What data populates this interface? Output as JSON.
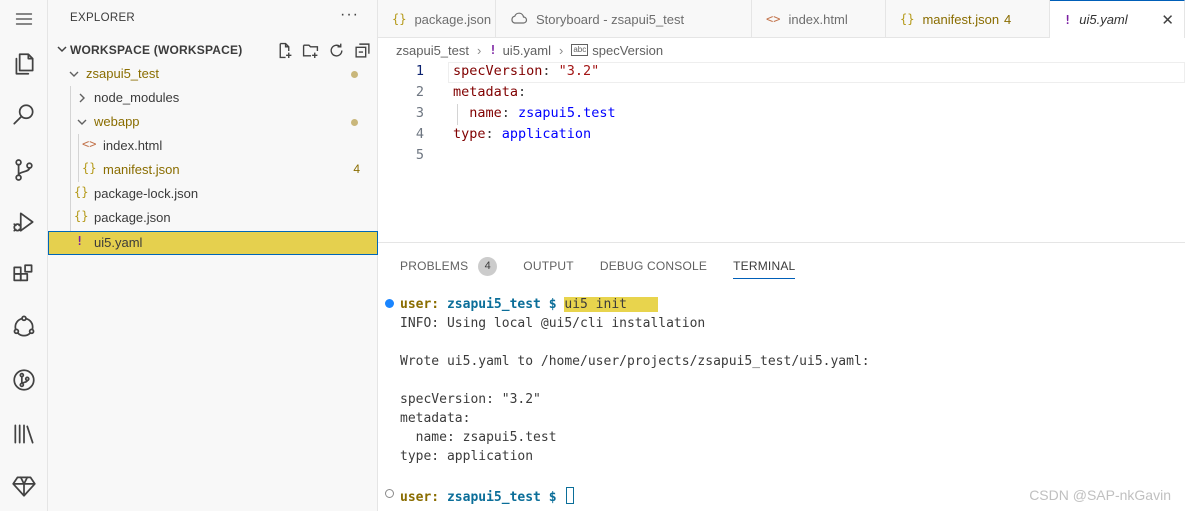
{
  "sidebar": {
    "title": "EXPLORER",
    "more": "···",
    "workspace_label": "WORKSPACE (WORKSPACE)",
    "items": [
      {
        "label": "zsapui5_test",
        "icon": "",
        "count": ""
      },
      {
        "label": "node_modules",
        "icon": "",
        "count": ""
      },
      {
        "label": "webapp",
        "icon": "",
        "count": ""
      },
      {
        "label": "index.html",
        "icon": "<>",
        "count": ""
      },
      {
        "label": "manifest.json",
        "icon": "{}",
        "count": "4"
      },
      {
        "label": "package-lock.json",
        "icon": "{}",
        "count": ""
      },
      {
        "label": "package.json",
        "icon": "{}",
        "count": ""
      },
      {
        "label": "ui5.yaml",
        "icon": "!",
        "count": ""
      }
    ]
  },
  "tabs": [
    {
      "label": "package.json",
      "icon": "{}",
      "count": ""
    },
    {
      "label": "Storyboard - zsapui5_test",
      "icon": "cloud-icon",
      "count": ""
    },
    {
      "label": "index.html",
      "icon": "<>",
      "count": ""
    },
    {
      "label": "manifest.json",
      "icon": "{}",
      "count": "4"
    },
    {
      "label": "ui5.yaml",
      "icon": "!",
      "count": "",
      "close": "✕"
    }
  ],
  "breadcrumb": {
    "folder": "zsapui5_test",
    "file": "ui5.yaml",
    "symbol_icon": "abc",
    "symbol": "specVersion"
  },
  "editor": {
    "line_numbers": [
      "1",
      "2",
      "3",
      "4",
      "5"
    ],
    "lines": [
      {
        "key": "specVersion",
        "sep": ": ",
        "val": "\"3.2\"",
        "val_kind": "s",
        "indent": ""
      },
      {
        "key": "metadata",
        "sep": ":",
        "val": "",
        "val_kind": "v",
        "indent": ""
      },
      {
        "key": "name",
        "sep": ": ",
        "val": "zsapui5.test",
        "val_kind": "v",
        "indent": "  "
      },
      {
        "key": "type",
        "sep": ": ",
        "val": "application",
        "val_kind": "v",
        "indent": ""
      },
      {
        "key": "",
        "sep": "",
        "val": "",
        "val_kind": "v",
        "indent": ""
      }
    ]
  },
  "panel": {
    "tabs": [
      "PROBLEMS",
      "OUTPUT",
      "DEBUG CONSOLE",
      "TERMINAL"
    ],
    "problems_count": "4"
  },
  "terminal": {
    "prompt_user": "user:",
    "prompt_dir": "zsapui5_test $",
    "command": "ui5 init    ",
    "output": [
      "INFO: Using local @ui5/cli installation",
      "",
      "Wrote ui5.yaml to /home/user/projects/zsapui5_test/ui5.yaml:",
      "",
      "specVersion: \"3.2\"",
      "metadata:",
      "  name: zsapui5.test",
      "type: application"
    ]
  },
  "watermark": "CSDN @SAP-nkGavin",
  "colors": {
    "accent": "#005fb8",
    "selection": "#e5d04e",
    "modified": "#8a6d00",
    "yaml_key": "#800000",
    "yaml_string": "#a31515",
    "yaml_value": "#0000ff"
  }
}
